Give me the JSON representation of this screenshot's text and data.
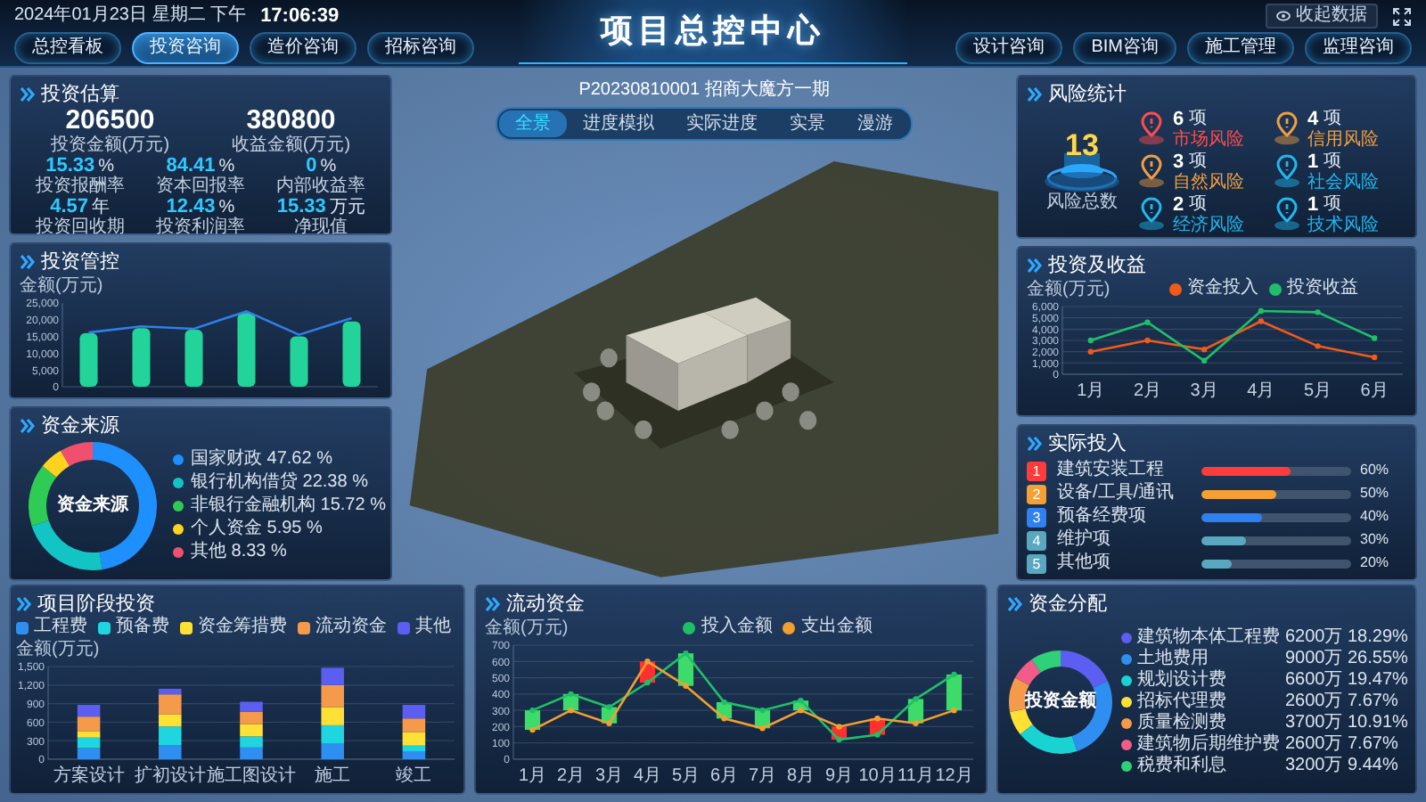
{
  "header": {
    "date": "2024年01月23日 星期二 下午",
    "time": "17:06:39",
    "title": "项目总控中心",
    "collapse_button": "收起数据",
    "nav_left": [
      {
        "label": "总控看板",
        "selected": false
      },
      {
        "label": "投资咨询",
        "selected": true
      },
      {
        "label": "造价咨询",
        "selected": false
      },
      {
        "label": "招标咨询",
        "selected": false
      }
    ],
    "nav_right": [
      {
        "label": "设计咨询",
        "selected": false
      },
      {
        "label": "BIM咨询",
        "selected": false
      },
      {
        "label": "施工管理",
        "selected": false
      },
      {
        "label": "监理咨询",
        "selected": false
      }
    ]
  },
  "project": {
    "name": "P20230810001 招商大魔方一期",
    "view_tabs": [
      {
        "label": "全景",
        "selected": true
      },
      {
        "label": "进度模拟",
        "selected": false
      },
      {
        "label": "实际进度",
        "selected": false
      },
      {
        "label": "实景",
        "selected": false
      },
      {
        "label": "漫游",
        "selected": false
      }
    ]
  },
  "investment_estimate": {
    "title": "投资估算",
    "totals": [
      {
        "value": "206500",
        "label": "投资金额(万元)"
      },
      {
        "value": "380800",
        "label": "收益金额(万元)"
      }
    ],
    "metrics": [
      {
        "value": "15.33",
        "unit": "%",
        "label": "投资报酬率"
      },
      {
        "value": "84.41",
        "unit": "%",
        "label": "资本回报率"
      },
      {
        "value": "0",
        "unit": "%",
        "label": "内部收益率"
      },
      {
        "value": "4.57",
        "unit": "年",
        "label": "投资回收期"
      },
      {
        "value": "12.43",
        "unit": "%",
        "label": "投资利润率"
      },
      {
        "value": "15.33",
        "unit": "万元",
        "label": "净现值"
      }
    ]
  },
  "investment_control": {
    "title": "投资管控",
    "chart_data": {
      "type": "bar",
      "ylabel": "金额(万元)",
      "ylim": [
        0,
        25000
      ],
      "yticks": [
        {
          "value": 0,
          "label": "0"
        },
        {
          "value": 5000,
          "label": "5,000"
        },
        {
          "value": 10000,
          "label": "10,000"
        },
        {
          "value": 15000,
          "label": "15,000"
        },
        {
          "value": 20000,
          "label": "20,000"
        },
        {
          "value": 25000,
          "label": "25,000"
        }
      ],
      "series": [
        {
          "color": "#22d39a",
          "values": [
            16000,
            17500,
            17000,
            22000,
            15000,
            19500
          ]
        },
        {
          "type": "line",
          "color": "#2f7fe8",
          "values": [
            16200,
            18000,
            17300,
            22500,
            15500,
            20500
          ]
        }
      ]
    }
  },
  "fund_sources": {
    "title": "资金来源",
    "center_label": "资金来源",
    "items": [
      {
        "label": "国家财政 47.62 %",
        "color": "#1e8fff"
      },
      {
        "label": "银行机构借贷 22.38 %",
        "color": "#13c4c4"
      },
      {
        "label": "非银行金融机构 15.72 %",
        "color": "#2ecc55"
      },
      {
        "label": "个人资金 5.95 %",
        "color": "#ffd21f"
      },
      {
        "label": "其他 8.33 %",
        "color": "#f0506e"
      }
    ],
    "chart_data": {
      "type": "donut",
      "values": [
        47.62,
        22.38,
        15.72,
        5.95,
        8.33
      ]
    }
  },
  "risk_stats": {
    "title": "风险统计",
    "total": "13",
    "total_label": "风险总数",
    "items": [
      {
        "count": "6",
        "unit": "项",
        "label": "市场风险",
        "color": "#ff4d4d"
      },
      {
        "count": "4",
        "unit": "项",
        "label": "信用风险",
        "color": "#f0a040"
      },
      {
        "count": "3",
        "unit": "项",
        "label": "自然风险",
        "color": "#f0a040"
      },
      {
        "count": "1",
        "unit": "项",
        "label": "社会风险",
        "color": "#1fb8f0"
      },
      {
        "count": "2",
        "unit": "项",
        "label": "经济风险",
        "color": "#1fb8f0"
      },
      {
        "count": "1",
        "unit": "项",
        "label": "技术风险",
        "color": "#1fb8f0"
      }
    ]
  },
  "investment_returns": {
    "title": "投资及收益",
    "chart_data": {
      "type": "line",
      "ylabel": "金额(万元)",
      "grid": true,
      "legend": "top",
      "categories": [
        "1月",
        "2月",
        "3月",
        "4月",
        "5月",
        "6月"
      ],
      "ylim": [
        0,
        6000
      ],
      "yticks": [
        {
          "value": 0,
          "label": "0"
        },
        {
          "value": 1000,
          "label": "1,000"
        },
        {
          "value": 2000,
          "label": "2,000"
        },
        {
          "value": 3000,
          "label": "3,000"
        },
        {
          "value": 4000,
          "label": "4,000"
        },
        {
          "value": 5000,
          "label": "5,000"
        },
        {
          "value": 6000,
          "label": "6,000"
        }
      ],
      "series": [
        {
          "name": "资金投入",
          "color": "#f05a1a",
          "marker": "circle",
          "values": [
            2000,
            3000,
            2200,
            4700,
            2500,
            1500
          ]
        },
        {
          "name": "投资收益",
          "color": "#1fbf6a",
          "marker": "circle",
          "values": [
            3000,
            4600,
            1200,
            5600,
            5500,
            3200
          ]
        }
      ]
    }
  },
  "actual_investment": {
    "title": "实际投入",
    "items": [
      {
        "rank": "1",
        "label": "建筑安装工程",
        "level": 0.6,
        "reading": "60%",
        "color": "#ff3b3b"
      },
      {
        "rank": "2",
        "label": "设备/工具/通讯",
        "level": 0.5,
        "reading": "50%",
        "color": "#f5a030"
      },
      {
        "rank": "3",
        "label": "预备经费项",
        "level": 0.4,
        "reading": "40%",
        "color": "#2f80f0"
      },
      {
        "rank": "4",
        "label": "维护项",
        "level": 0.3,
        "reading": "30%",
        "color": "#5aa8c0"
      },
      {
        "rank": "5",
        "label": "其他项",
        "level": 0.2,
        "reading": "20%",
        "color": "#5aa8c0"
      }
    ]
  },
  "stage_investment": {
    "title": "项目阶段投资",
    "chart_data": {
      "type": "bar",
      "stacked": true,
      "grid": true,
      "legend": "top",
      "ylabel": "金额(万元)",
      "categories": [
        "方案设计",
        "扩初设计",
        "施工图设计",
        "施工",
        "竣工"
      ],
      "ylim": [
        0,
        1500
      ],
      "yticks": [
        {
          "value": 0,
          "label": "0"
        },
        {
          "value": 300,
          "label": "300"
        },
        {
          "value": 600,
          "label": "600"
        },
        {
          "value": 900,
          "label": "900"
        },
        {
          "value": 1200,
          "label": "1,200"
        },
        {
          "value": 1500,
          "label": "1,500"
        }
      ],
      "series": [
        {
          "name": "工程费",
          "color": "#2f8ff0",
          "values": [
            180,
            230,
            190,
            250,
            130
          ]
        },
        {
          "name": "预备费",
          "color": "#1fd6e0",
          "values": [
            170,
            300,
            180,
            300,
            90
          ]
        },
        {
          "name": "资金筹措费",
          "color": "#ffe135",
          "values": [
            100,
            200,
            200,
            290,
            220
          ]
        },
        {
          "name": "流动资金",
          "color": "#f59a4a",
          "values": [
            240,
            320,
            200,
            360,
            220
          ]
        },
        {
          "name": "其他",
          "color": "#5b5ef0",
          "values": [
            190,
            90,
            160,
            280,
            220
          ]
        }
      ]
    }
  },
  "working_capital": {
    "title": "流动资金",
    "chart_data": {
      "type": "line",
      "ylabel": "金额(万元)",
      "grid": true,
      "legend": "top",
      "categories": [
        "1月",
        "2月",
        "3月",
        "4月",
        "5月",
        "6月",
        "7月",
        "8月",
        "9月",
        "10月",
        "11月",
        "12月"
      ],
      "ylim": [
        0,
        700
      ],
      "yticks": [
        0,
        100,
        200,
        300,
        400,
        500,
        600,
        700
      ],
      "series": [
        {
          "name": "投入金额",
          "color": "#1fbf6a",
          "marker": "circle",
          "values": [
            300,
            400,
            320,
            470,
            650,
            350,
            300,
            360,
            120,
            150,
            370,
            520
          ]
        },
        {
          "name": "支出金额",
          "color": "#f0a030",
          "marker": "circle",
          "values": [
            180,
            300,
            220,
            600,
            450,
            250,
            190,
            300,
            200,
            250,
            220,
            300
          ]
        }
      ]
    }
  },
  "fund_allocation": {
    "title": "资金分配",
    "center_label": "投资金额",
    "items": [
      {
        "name": "建筑物本体工程费",
        "amount": "6200万",
        "percent": "18.29%",
        "color": "#5b5ef0"
      },
      {
        "name": "土地费用",
        "amount": "9000万",
        "percent": "26.55%",
        "color": "#2f8ff0"
      },
      {
        "name": "规划设计费",
        "amount": "6600万",
        "percent": "19.47%",
        "color": "#19d3d3"
      },
      {
        "name": "招标代理费",
        "amount": "2600万",
        "percent": "7.67%",
        "color": "#ffe135"
      },
      {
        "name": "质量检测费",
        "amount": "3700万",
        "percent": "10.91%",
        "color": "#f59a4a"
      },
      {
        "name": "建筑物后期维护费",
        "amount": "2600万",
        "percent": "7.67%",
        "color": "#f25c8a"
      },
      {
        "name": "税费和利息",
        "amount": "3200万",
        "percent": "9.44%",
        "color": "#2ed07a"
      }
    ],
    "chart_data": {
      "type": "donut",
      "values": [
        18.29,
        26.55,
        19.47,
        7.67,
        10.91,
        7.67,
        9.44
      ]
    }
  }
}
